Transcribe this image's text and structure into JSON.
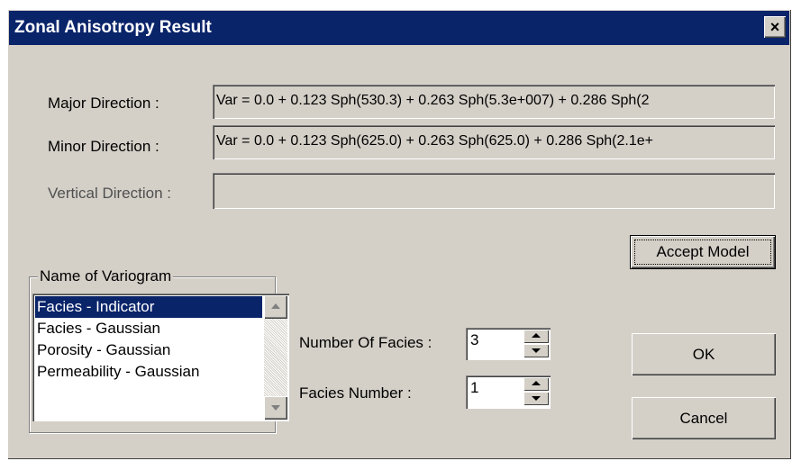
{
  "window": {
    "title": "Zonal Anisotropy Result",
    "close_glyph": "×"
  },
  "directions": {
    "major_label": "Major Direction :",
    "major_value": "Var =   0.0 + 0.123 Sph(530.3) + 0.263 Sph(5.3e+007) + 0.286 Sph(2",
    "minor_label": "Minor Direction :",
    "minor_value": "Var =   0.0 + 0.123 Sph(625.0) + 0.263 Sph(625.0) + 0.286 Sph(2.1e+",
    "vertical_label": "Vertical Direction :",
    "vertical_value": ""
  },
  "buttons": {
    "accept_model": "Accept Model",
    "ok": "OK",
    "cancel": "Cancel"
  },
  "variogram_group": {
    "label": "Name of Variogram",
    "items": [
      {
        "label": "Facies - Indicator",
        "selected": true
      },
      {
        "label": "Facies - Gaussian",
        "selected": false
      },
      {
        "label": "Porosity - Gaussian",
        "selected": false
      },
      {
        "label": "Permeability - Gaussian",
        "selected": false
      }
    ]
  },
  "facies": {
    "count_label": "Number Of Facies :",
    "count_value": "3",
    "number_label": "Facies Number :",
    "number_value": "1"
  },
  "colors": {
    "titlebar": "#0a246a",
    "dialog_face": "#d4d0c8",
    "selection": "#0a246a"
  }
}
